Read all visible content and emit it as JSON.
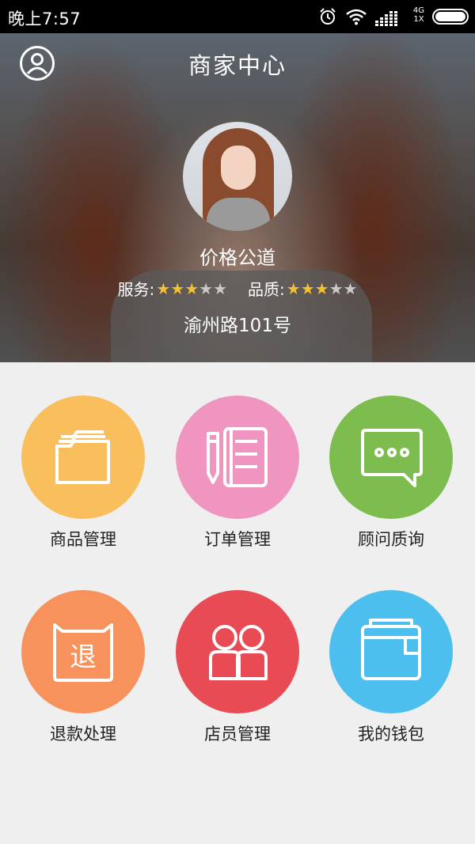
{
  "status_bar": {
    "time": "晚上7:57",
    "network_top": "4G",
    "network_bottom": "1X"
  },
  "header": {
    "title": "商家中心",
    "user_icon": "user-circle-icon"
  },
  "merchant": {
    "name": "价格公道",
    "service_label": "服务:",
    "service_stars": 3,
    "quality_label": "品质:",
    "quality_stars": 3,
    "max_stars": 5,
    "address": "渝州路101号"
  },
  "menu": [
    {
      "label": "商品管理",
      "icon": "folder-icon",
      "color": "#f9bf5c"
    },
    {
      "label": "订单管理",
      "icon": "notepad-pen-icon",
      "color": "#f095bf"
    },
    {
      "label": "顾问质询",
      "icon": "chat-bubble-icon",
      "color": "#7dbd4f"
    },
    {
      "label": "退款处理",
      "icon": "refund-bag-icon",
      "color": "#f7925c"
    },
    {
      "label": "店员管理",
      "icon": "staff-icon",
      "color": "#e94b55"
    },
    {
      "label": "我的钱包",
      "icon": "wallet-icon",
      "color": "#4dbfef"
    }
  ],
  "refund_icon_char": "退"
}
